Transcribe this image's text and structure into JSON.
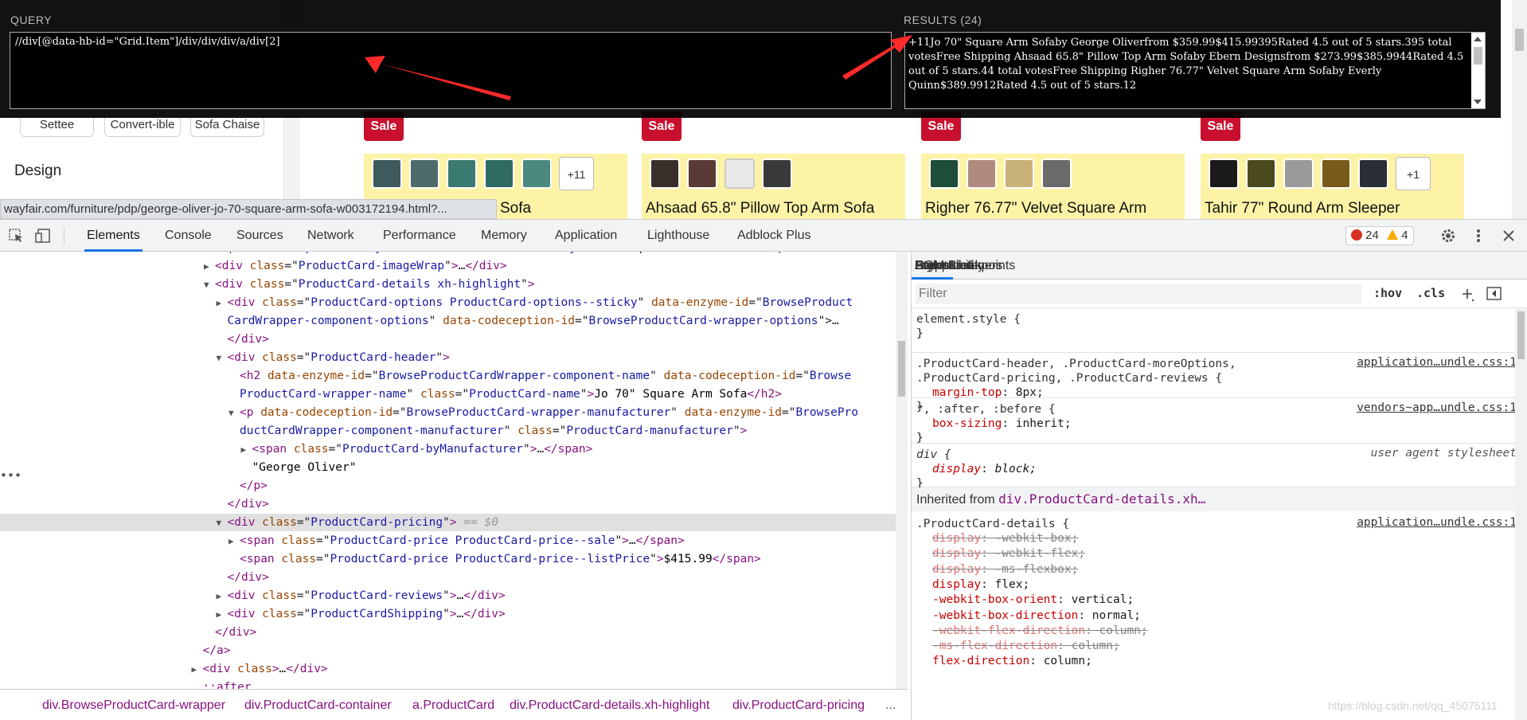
{
  "page": {
    "left_panel": {
      "categories": [
        {
          "label": "Settee"
        },
        {
          "label": "Convert-ible"
        },
        {
          "label": "Sofa Chaise"
        }
      ],
      "design_heading": "Design"
    },
    "products": [
      {
        "badge": "Sale",
        "name": "Sofa",
        "more_swatches": "+11",
        "swatch_colors": [
          "#3f5a5c",
          "#4d6b6a",
          "#3b7a71",
          "#2f6a63",
          "#4a8a7e"
        ]
      },
      {
        "badge": "Sale",
        "name": "Ahsaad 65.8\" Pillow Top Arm Sofa",
        "more_swatches": "",
        "swatch_colors": [
          "#3a2e2a",
          "#5a3a34",
          "#e8e8e8",
          "#3a3a3a"
        ]
      },
      {
        "badge": "Sale",
        "name": "Righer 76.77\" Velvet Square Arm",
        "more_swatches": "",
        "swatch_colors": [
          "#1e4d3a",
          "#b08a7e",
          "#c9b27a",
          "#6a6a6a"
        ]
      },
      {
        "badge": "Sale",
        "name": "Tahir 77\" Round Arm Sleeper",
        "more_swatches": "+1",
        "swatch_colors": [
          "#1a1a1a",
          "#4a4a1e",
          "#9a9a9a",
          "#7a5a1a",
          "#2a2e36"
        ]
      }
    ],
    "status_url": "wayfair.com/furniture/pdp/george-oliver-jo-70-square-arm-sofa-w003172194.html?..."
  },
  "xpath_helper": {
    "query_label": "QUERY",
    "query": "//div[@data-hb-id=\"Grid.Item\"]/div/div/div/a/div[2]",
    "results_label": "RESULTS (24)",
    "results_text": "+11Jo 70\" Square Arm Sofaby  George Oliverfrom $359.99$415.99395Rated 4.5 out of 5 stars.395 total votesFree Shipping Ahsaad 65.8\" Pillow Top Arm Sofaby  Ebern Designsfrom $273.99$385.9944Rated 4.5 out of 5 stars.44 total votesFree Shipping Righer 76.77\" Velvet Square Arm Sofaby  Everly Quinn$389.9912Rated 4.5 out of 5 stars.12"
  },
  "devtools": {
    "tabs": [
      {
        "label": "Elements",
        "active": true
      },
      {
        "label": "Console"
      },
      {
        "label": "Sources"
      },
      {
        "label": "Network"
      },
      {
        "label": "Performance"
      },
      {
        "label": "Memory"
      },
      {
        "label": "Application"
      },
      {
        "label": "Lighthouse"
      },
      {
        "label": "Adblock Plus"
      }
    ],
    "errors": "24",
    "warnings": "4",
    "dom_lines": [
      {
        "indent": 1,
        "html": "<span class=\"tri\"></span><span class=\"tag\">&lt;span</span> <span class=\"attr\">class</span>=\"<span class=\"val\">pl-VisuallyHidden</span>\" <span class=\"attr\">data-hb-id</span>=\"<span class=\"val\">VisuallyHidden</span>\"&gt;<span class=\"txt\">Opens in a new tab</span><span class=\"tag\">&lt;/span&gt;</span>"
      },
      {
        "indent": 1,
        "html": "<span class=\"tri\">▶</span><span class=\"tag\">&lt;div</span> <span class=\"attr\">class</span>=\"<span class=\"val\">ProductCard-imageWrap</span>\"<span class=\"tag\">&gt;</span>…<span class=\"tag\">&lt;/div&gt;</span>"
      },
      {
        "indent": 1,
        "html": "<span class=\"tri\">▼</span><span class=\"tag\">&lt;div</span> <span class=\"attr\">class</span>=\"<span class=\"val\">ProductCard-details xh-highlight</span>\"<span class=\"tag\">&gt;</span>"
      },
      {
        "indent": 2,
        "html": "<span class=\"tri\">▶</span><span class=\"tag\">&lt;div</span> <span class=\"attr\">class</span>=\"<span class=\"val\">ProductCard-options ProductCard-options--sticky</span>\" <span class=\"attr\">data-enzyme-id</span>=\"<span class=\"val\">BrowseProduct</span>"
      },
      {
        "indent": 2,
        "html": "<span class=\"tri\"></span><span class=\"val\">CardWrapper-component-options</span>\" <span class=\"attr\">data-codeception-id</span>=\"<span class=\"val\">BrowseProductCard-wrapper-options</span>\"&gt;…"
      },
      {
        "indent": 2,
        "html": "<span class=\"tri\"></span><span class=\"tag\">&lt;/div&gt;</span>"
      },
      {
        "indent": 2,
        "html": "<span class=\"tri\">▼</span><span class=\"tag\">&lt;div</span> <span class=\"attr\">class</span>=\"<span class=\"val\">ProductCard-header</span>\"<span class=\"tag\">&gt;</span>"
      },
      {
        "indent": 3,
        "html": "<span class=\"tri\"></span><span class=\"tag\">&lt;h2</span> <span class=\"attr\">data-enzyme-id</span>=\"<span class=\"val\">BrowseProductCardWrapper-component-name</span>\" <span class=\"attr\">data-codeception-id</span>=\"<span class=\"val\">Browse</span>"
      },
      {
        "indent": 3,
        "html": "<span class=\"tri\"></span><span class=\"val\">ProductCard-wrapper-name</span>\" <span class=\"attr\">class</span>=\"<span class=\"val\">ProductCard-name</span>\"<span class=\"tag\">&gt;</span><span class=\"txt\">Jo 70\" Square Arm Sofa</span><span class=\"tag\">&lt;/h2&gt;</span>"
      },
      {
        "indent": 3,
        "html": "<span class=\"tri\">▼</span><span class=\"tag\">&lt;p</span> <span class=\"attr\">data-codeception-id</span>=\"<span class=\"val\">BrowseProductCard-wrapper-manufacturer</span>\" <span class=\"attr\">data-enzyme-id</span>=\"<span class=\"val\">BrowsePro</span>"
      },
      {
        "indent": 3,
        "html": "<span class=\"tri\"></span><span class=\"val\">ductCardWrapper-component-manufacturer</span>\" <span class=\"attr\">class</span>=\"<span class=\"val\">ProductCard-manufacturer</span>\"<span class=\"tag\">&gt;</span>"
      },
      {
        "indent": 4,
        "html": "<span class=\"tri\">▶</span><span class=\"tag\">&lt;span</span> <span class=\"attr\">class</span>=\"<span class=\"val\">ProductCard-byManufacturer</span>\"<span class=\"tag\">&gt;</span>…<span class=\"tag\">&lt;/span&gt;</span>"
      },
      {
        "indent": 4,
        "html": "<span class=\"tri\"></span><span class=\"txt\">\"George Oliver\"</span>"
      },
      {
        "indent": 3,
        "html": "<span class=\"tri\"></span><span class=\"tag\">&lt;/p&gt;</span>"
      },
      {
        "indent": 2,
        "html": "<span class=\"tri\"></span><span class=\"tag\">&lt;/div&gt;</span>"
      },
      {
        "indent": 2,
        "selected": true,
        "html": "<span class=\"tri\">▼</span><span class=\"tag\">&lt;div</span> <span class=\"attr\">class</span>=\"<span class=\"val\">ProductCard-pricing</span>\"<span class=\"tag\">&gt;</span> <span class=\"ph\">== $0</span>"
      },
      {
        "indent": 3,
        "html": "<span class=\"tri\">▶</span><span class=\"tag\">&lt;span</span> <span class=\"attr\">class</span>=\"<span class=\"val\">ProductCard-price ProductCard-price--sale</span>\"<span class=\"tag\">&gt;</span>…<span class=\"tag\">&lt;/span&gt;</span>"
      },
      {
        "indent": 3,
        "html": "<span class=\"tri\"></span><span class=\"tag\">&lt;span</span> <span class=\"attr\">class</span>=\"<span class=\"val\">ProductCard-price ProductCard-price--listPrice</span>\"<span class=\"tag\">&gt;</span><span class=\"txt\">$415.99</span><span class=\"tag\">&lt;/span&gt;</span>"
      },
      {
        "indent": 2,
        "html": "<span class=\"tri\"></span><span class=\"tag\">&lt;/div&gt;</span>"
      },
      {
        "indent": 2,
        "html": "<span class=\"tri\">▶</span><span class=\"tag\">&lt;div</span> <span class=\"attr\">class</span>=\"<span class=\"val\">ProductCard-reviews</span>\"<span class=\"tag\">&gt;</span>…<span class=\"tag\">&lt;/div&gt;</span>"
      },
      {
        "indent": 2,
        "html": "<span class=\"tri\">▶</span><span class=\"tag\">&lt;div</span> <span class=\"attr\">class</span>=\"<span class=\"val\">ProductCardShipping</span>\"<span class=\"tag\">&gt;</span>…<span class=\"tag\">&lt;/div&gt;</span>"
      },
      {
        "indent": 1,
        "html": "<span class=\"tri\"></span><span class=\"tag\">&lt;/div&gt;</span>"
      },
      {
        "indent": 0,
        "html": "<span class=\"tri\"></span><span class=\"tag\">&lt;/a&gt;</span>"
      },
      {
        "indent": 0,
        "html": "<span class=\"tri\">▶</span><span class=\"tag\">&lt;div</span> <span class=\"attr\">class</span><span class=\"tag\">&gt;</span>…<span class=\"tag\">&lt;/div&gt;</span>"
      },
      {
        "indent": 0,
        "html": "<span class=\"tri\"></span><span class=\"tag\">::after</span>"
      }
    ],
    "breadcrumbs": [
      "div.BrowseProductCard-wrapper",
      "div.ProductCard-container",
      "a.ProductCard",
      "div.ProductCard-details.xh-highlight",
      "div.ProductCard-pricing"
    ],
    "breadcrumb_more": "...",
    "side_tabs": [
      {
        "label": "Styles",
        "active": true
      },
      {
        "label": "Computed"
      },
      {
        "label": "Layout"
      },
      {
        "label": "Event Listeners"
      },
      {
        "label": "DOM Breakpoints"
      },
      {
        "label": "Properties"
      },
      {
        "label": "Accessibility"
      }
    ],
    "filter_placeholder": "Filter",
    "hov_label": ":hov",
    "cls_label": ".cls",
    "rules": [
      {
        "selector": "element.style {",
        "source": "",
        "props": [],
        "close": "}"
      },
      {
        "selector": ".ProductCard-header, .ProductCard-moreOptions,",
        "selector2": ".ProductCard-pricing, .ProductCard-reviews {",
        "source": "application…undle.css:1",
        "props": [
          {
            "name": "margin-top",
            "value": "8px;"
          }
        ],
        "close": "}"
      },
      {
        "selector": "*, :after, :before {",
        "source": "vendors~app…undle.css:1",
        "props": [
          {
            "name": "box-sizing",
            "value": "inherit;"
          }
        ],
        "close": "}"
      },
      {
        "selector": "div {",
        "source": "user agent stylesheet",
        "props": [
          {
            "name": "display",
            "value": "block;"
          }
        ],
        "close": "}"
      }
    ],
    "inherited_label": "Inherited from",
    "inherited_from": "div.ProductCard-details.xh…",
    "details_rule": {
      "selector": ".ProductCard-details {",
      "source": "application…undle.css:1",
      "props": [
        {
          "name": "display",
          "value": "-webkit-box;",
          "struck": true
        },
        {
          "name": "display",
          "value": "-webkit-flex;",
          "struck": true
        },
        {
          "name": "display",
          "value": "-ms-flexbox;",
          "struck": true
        },
        {
          "name": "display",
          "value": "flex;"
        },
        {
          "name": "-webkit-box-orient",
          "value": "vertical;"
        },
        {
          "name": "-webkit-box-direction",
          "value": "normal;"
        },
        {
          "name": "-webkit-flex-direction",
          "value": "column;",
          "struck": true
        },
        {
          "name": "-ms-flex-direction",
          "value": "column;",
          "struck": true
        },
        {
          "name": "flex-direction",
          "value": "column;"
        }
      ]
    },
    "watermark": "https://blog.csdn.net/qq_45075111"
  }
}
